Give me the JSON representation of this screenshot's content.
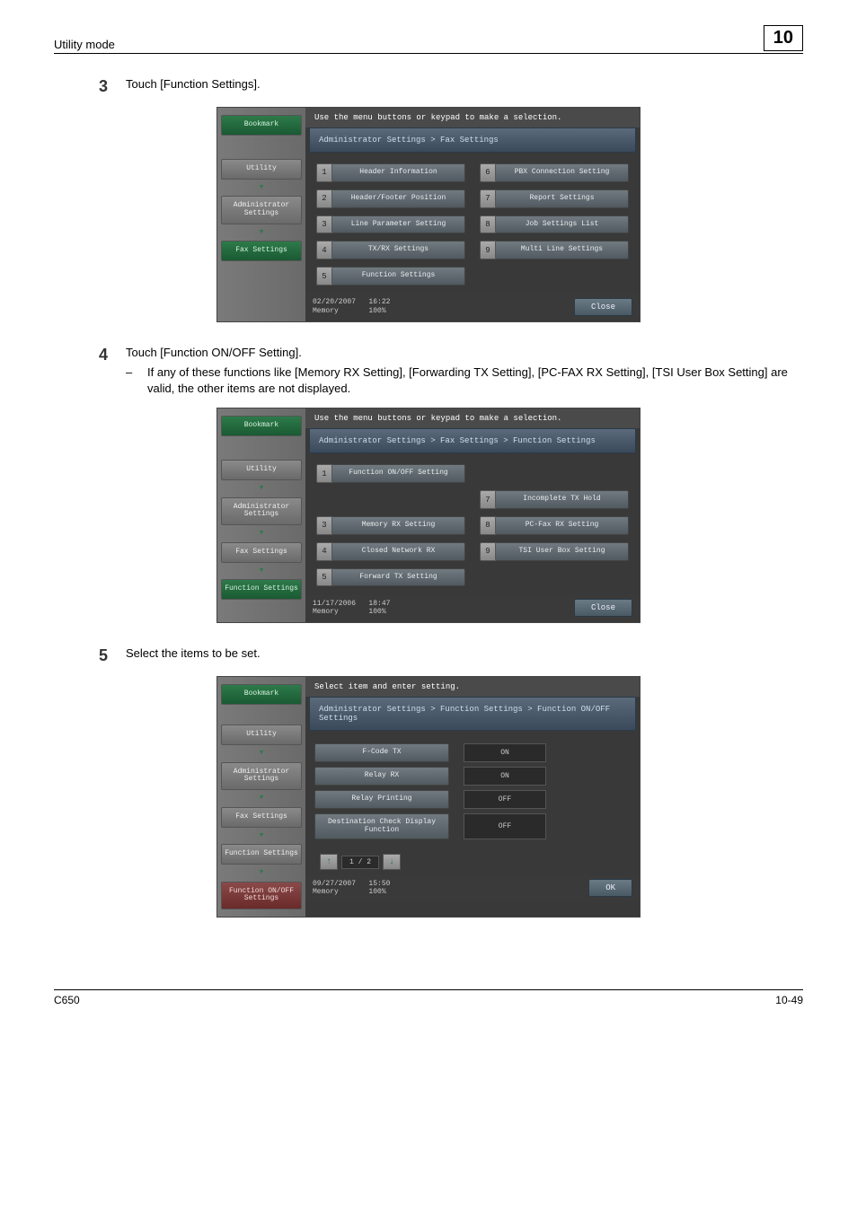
{
  "header": {
    "title": "Utility mode",
    "chapter": "10"
  },
  "steps": {
    "s3": {
      "num": "3",
      "text": "Touch [Function Settings]."
    },
    "s4": {
      "num": "4",
      "text": "Touch [Function ON/OFF Setting].",
      "sub": "If any of these functions like [Memory RX Setting], [Forwarding TX Setting], [PC-FAX RX Setting], [TSI User Box Setting] are valid, the other items are not displayed."
    },
    "s5": {
      "num": "5",
      "text": "Select the items to be set."
    }
  },
  "screen1": {
    "top": "Use the menu buttons or keypad to make a selection.",
    "crumb": "Administrator Settings  > Fax Settings",
    "side": {
      "bookmark": "Bookmark",
      "utility": "Utility",
      "admin": "Administrator Settings",
      "fax": "Fax Settings"
    },
    "items": {
      "i1": "Header Information",
      "i2": "Header/Footer Position",
      "i3": "Line Parameter Setting",
      "i4": "TX/RX Settings",
      "i5": "Function Settings",
      "i6": "PBX Connection Setting",
      "i7": "Report Settings",
      "i8": "Job Settings List",
      "i9": "Multi Line Settings"
    },
    "foot": {
      "date": "02/20/2007",
      "time": "16:22",
      "mem": "Memory",
      "pct": "100%",
      "close": "Close"
    }
  },
  "screen2": {
    "top": "Use the menu buttons or keypad to make a selection.",
    "crumb": "Administrator Settings > Fax Settings > Function Settings",
    "side": {
      "bookmark": "Bookmark",
      "utility": "Utility",
      "admin": "Administrator Settings",
      "fax": "Fax Settings",
      "func": "Function Settings"
    },
    "items": {
      "i1": "Function ON/OFF Setting",
      "i3": "Memory RX Setting",
      "i4": "Closed Network RX",
      "i5": "Forward TX Setting",
      "i7": "Incomplete TX Hold",
      "i8": "PC-Fax RX Setting",
      "i9": "TSI User Box Setting"
    },
    "foot": {
      "date": "11/17/2006",
      "time": "18:47",
      "mem": "Memory",
      "pct": "100%",
      "close": "Close"
    }
  },
  "screen3": {
    "top": "Select item and enter setting.",
    "crumb": "Administrator Settings > Function Settings > Function ON/OFF Settings",
    "side": {
      "bookmark": "Bookmark",
      "utility": "Utility",
      "admin": "Administrator Settings",
      "fax": "Fax Settings",
      "func": "Function Settings",
      "onoff": "Function ON/OFF Settings"
    },
    "rows": [
      {
        "label": "F-Code TX",
        "val": "ON"
      },
      {
        "label": "Relay RX",
        "val": "ON"
      },
      {
        "label": "Relay Printing",
        "val": "OFF"
      },
      {
        "label": "Destination Check Display Function",
        "val": "OFF"
      }
    ],
    "pager": "1 / 2",
    "foot": {
      "date": "09/27/2007",
      "time": "15:50",
      "mem": "Memory",
      "pct": "100%",
      "ok": "OK"
    }
  },
  "footer": {
    "left": "C650",
    "right": "10-49"
  }
}
